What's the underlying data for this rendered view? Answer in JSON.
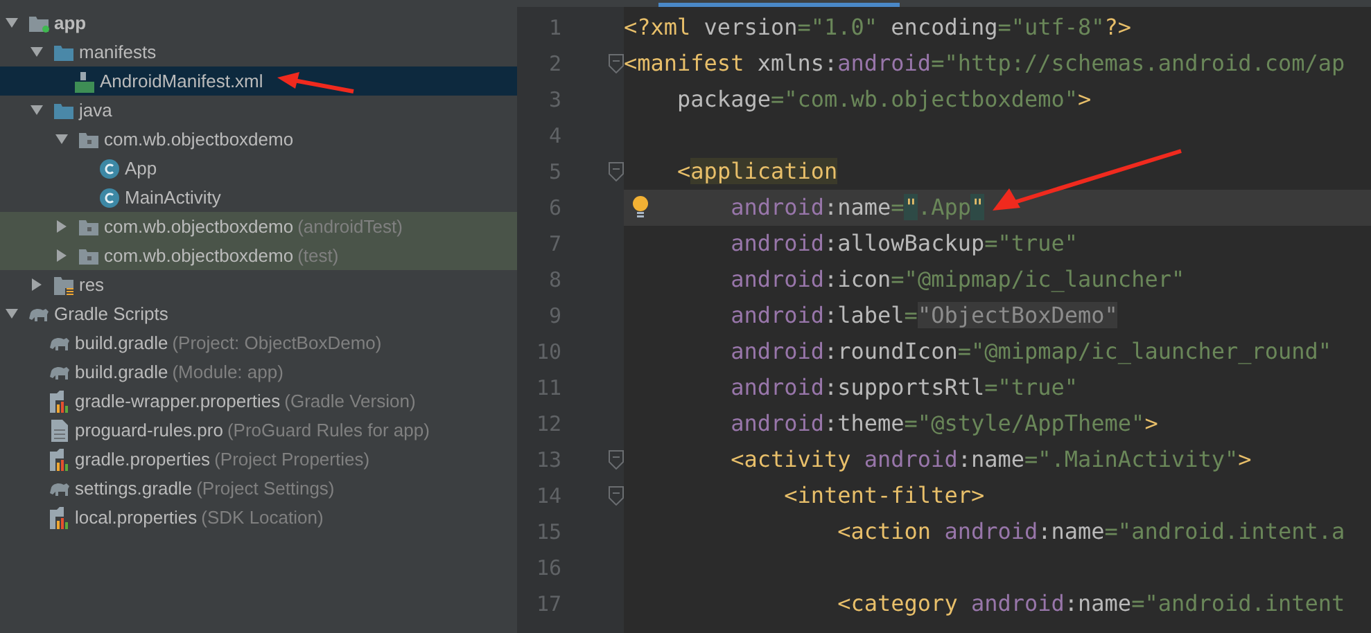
{
  "project_tree": [
    {
      "label": "app",
      "kind": "module",
      "expanded": true,
      "bold": true,
      "children": [
        {
          "label": "manifests",
          "kind": "folder",
          "expanded": true,
          "children": [
            {
              "label": "AndroidManifest.xml",
              "kind": "manifest",
              "selected": true
            }
          ]
        },
        {
          "label": "java",
          "kind": "folder",
          "expanded": true,
          "children": [
            {
              "label": "com.wb.objectboxdemo",
              "kind": "package",
              "expanded": true,
              "children": [
                {
                  "label": "App",
                  "kind": "class",
                  "selected": false
                },
                {
                  "label": "MainActivity",
                  "kind": "class",
                  "selected": false
                }
              ]
            },
            {
              "label": "com.wb.objectboxdemo",
              "note": "(androidTest)",
              "kind": "package",
              "expanded": false,
              "tinted": true
            },
            {
              "label": "com.wb.objectboxdemo",
              "note": "(test)",
              "kind": "package",
              "expanded": false,
              "tinted": true
            }
          ]
        },
        {
          "label": "res",
          "kind": "res",
          "expanded": false
        }
      ]
    },
    {
      "label": "Gradle Scripts",
      "kind": "gradle",
      "expanded": true,
      "children": [
        {
          "label": "build.gradle",
          "note": "(Project: ObjectBoxDemo)",
          "kind": "gradle",
          "selected": false
        },
        {
          "label": "build.gradle",
          "note": "(Module: app)",
          "kind": "gradle",
          "selected": false
        },
        {
          "label": "gradle-wrapper.properties",
          "note": "(Gradle Version)",
          "kind": "props",
          "selected": false
        },
        {
          "label": "proguard-rules.pro",
          "note": "(ProGuard Rules for app)",
          "kind": "file",
          "selected": false
        },
        {
          "label": "gradle.properties",
          "note": "(Project Properties)",
          "kind": "props",
          "selected": false
        },
        {
          "label": "settings.gradle",
          "note": "(Project Settings)",
          "kind": "gradle",
          "selected": false
        },
        {
          "label": "local.properties",
          "note": "(SDK Location)",
          "kind": "props",
          "selected": false
        }
      ]
    }
  ],
  "editor": {
    "lines": [
      {
        "number": "1",
        "tokens": [
          {
            "kind": "tag",
            "text": "<?xml "
          },
          {
            "kind": "attr",
            "text": "version"
          },
          {
            "kind": "str",
            "text": "=\"1.0\" "
          },
          {
            "kind": "attr",
            "text": "encoding"
          },
          {
            "kind": "str",
            "text": "=\"utf-8\""
          },
          {
            "kind": "tag",
            "text": "?>"
          }
        ]
      },
      {
        "number": "2",
        "fold": true,
        "tokens": [
          {
            "kind": "tag",
            "text": "<manifest "
          },
          {
            "kind": "attr",
            "text": "xmlns:"
          },
          {
            "kind": "ns",
            "text": "android"
          },
          {
            "kind": "str",
            "text": "=\"http://schemas.android.com/ap"
          }
        ]
      },
      {
        "number": "3",
        "tokens": [
          {
            "kind": "attr",
            "text": "    package"
          },
          {
            "kind": "str",
            "text": "=\"com.wb.objectboxdemo\""
          },
          {
            "kind": "tag",
            "text": ">"
          }
        ]
      },
      {
        "number": "4"
      },
      {
        "number": "5",
        "fold": true,
        "tokens": [
          {
            "kind": "tag",
            "text": "    <"
          },
          {
            "kind": "tag",
            "text": "application",
            "marked": true
          }
        ]
      },
      {
        "number": "6",
        "current": true,
        "bulb": true,
        "tokens": [
          {
            "kind": "ns",
            "text": "        android"
          },
          {
            "kind": "attr",
            "text": ":name"
          },
          {
            "kind": "str",
            "text": "="
          },
          {
            "kind": "quote",
            "text": "\"",
            "marked": true
          },
          {
            "kind": "str",
            "text": ".App"
          },
          {
            "kind": "quote",
            "text": "\"",
            "marked": true
          }
        ]
      },
      {
        "number": "7",
        "tokens": [
          {
            "kind": "ns",
            "text": "        android"
          },
          {
            "kind": "attr",
            "text": ":allowBackup"
          },
          {
            "kind": "str",
            "text": "=\"true\""
          }
        ]
      },
      {
        "number": "8",
        "tokens": [
          {
            "kind": "ns",
            "text": "        android"
          },
          {
            "kind": "attr",
            "text": ":icon"
          },
          {
            "kind": "str",
            "text": "=\"@mipmap/ic_launcher\""
          }
        ]
      },
      {
        "number": "9",
        "tokens": [
          {
            "kind": "ns",
            "text": "        android"
          },
          {
            "kind": "attr",
            "text": ":label"
          },
          {
            "kind": "str",
            "text": "="
          },
          {
            "kind": "muted",
            "text": "\"ObjectBoxDemo\"",
            "marked": true
          }
        ]
      },
      {
        "number": "10",
        "tokens": [
          {
            "kind": "ns",
            "text": "        android"
          },
          {
            "kind": "attr",
            "text": ":roundIcon"
          },
          {
            "kind": "str",
            "text": "=\"@mipmap/ic_launcher_round\""
          }
        ]
      },
      {
        "number": "11",
        "tokens": [
          {
            "kind": "ns",
            "text": "        android"
          },
          {
            "kind": "attr",
            "text": ":supportsRtl"
          },
          {
            "kind": "str",
            "text": "=\"true\""
          }
        ]
      },
      {
        "number": "12",
        "tokens": [
          {
            "kind": "ns",
            "text": "        android"
          },
          {
            "kind": "attr",
            "text": ":theme"
          },
          {
            "kind": "str",
            "text": "=\"@style/AppTheme\""
          },
          {
            "kind": "tag",
            "text": ">"
          }
        ]
      },
      {
        "number": "13",
        "fold": true,
        "tokens": [
          {
            "kind": "tag",
            "text": "        <activity "
          },
          {
            "kind": "ns",
            "text": "android"
          },
          {
            "kind": "attr",
            "text": ":name"
          },
          {
            "kind": "str",
            "text": "=\".MainActivity\""
          },
          {
            "kind": "tag",
            "text": ">"
          }
        ]
      },
      {
        "number": "14",
        "fold": true,
        "tokens": [
          {
            "kind": "tag",
            "text": "            <intent-filter>"
          }
        ]
      },
      {
        "number": "15",
        "tokens": [
          {
            "kind": "tag",
            "text": "                <action "
          },
          {
            "kind": "ns",
            "text": "android"
          },
          {
            "kind": "attr",
            "text": ":name"
          },
          {
            "kind": "str",
            "text": "=\"android.intent.a"
          }
        ]
      },
      {
        "number": "16"
      },
      {
        "number": "17",
        "tokens": [
          {
            "kind": "tag",
            "text": "                <category "
          },
          {
            "kind": "ns",
            "text": "android"
          },
          {
            "kind": "attr",
            "text": ":name"
          },
          {
            "kind": "str",
            "text": "=\"android.intent"
          }
        ]
      }
    ]
  }
}
